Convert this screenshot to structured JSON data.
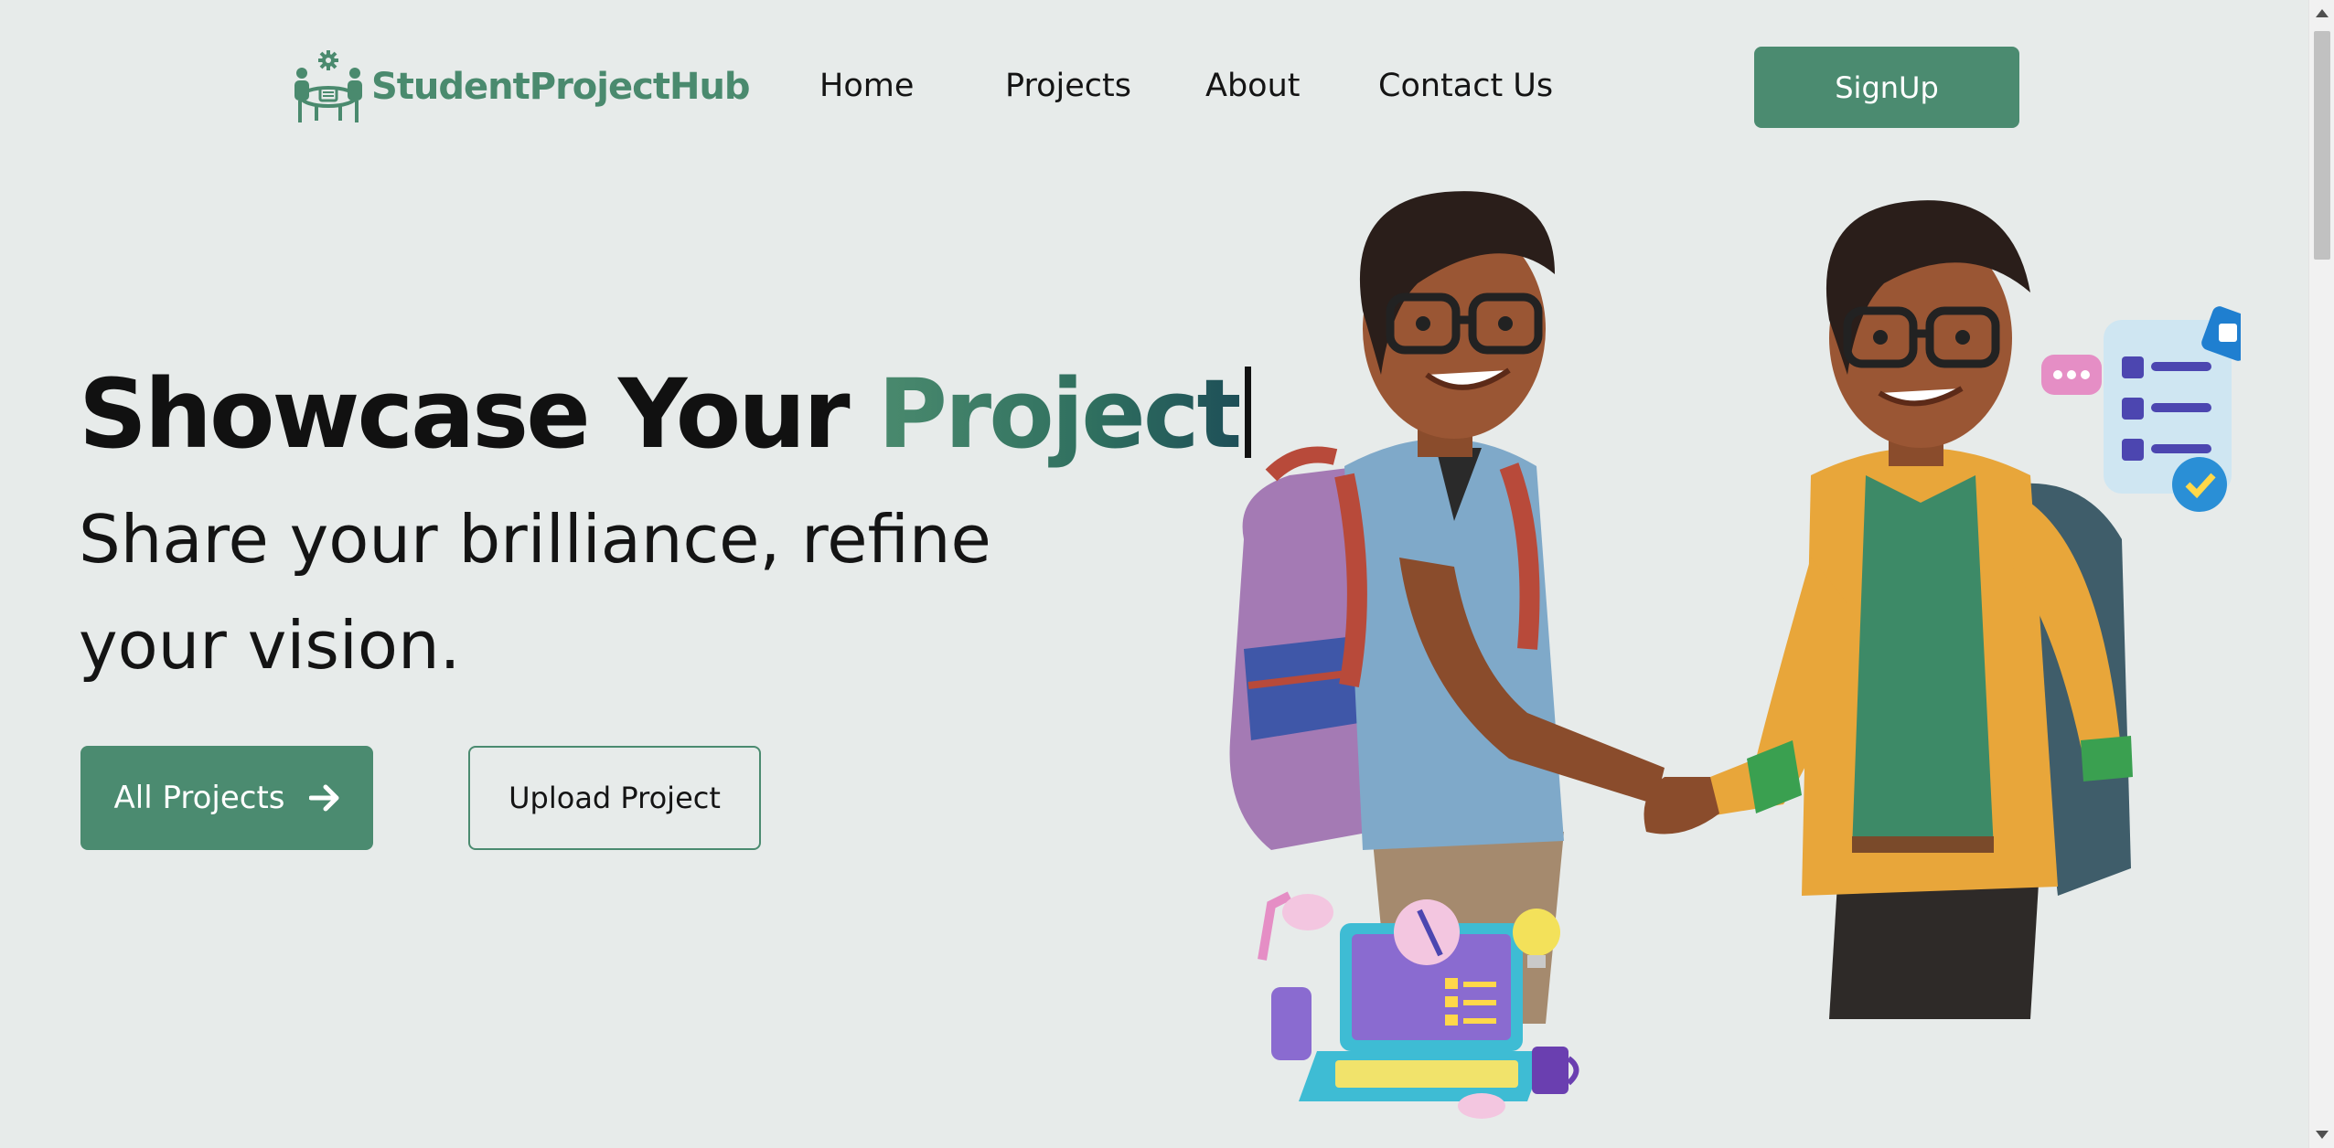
{
  "brand": {
    "name": "StudentProjectHub",
    "logo_icon": "team-meeting-gear-icon",
    "color": "#4b8b70"
  },
  "nav": {
    "links": [
      "Home",
      "Projects",
      "About",
      "Contact Us"
    ],
    "signup_label": "SignUp"
  },
  "hero": {
    "title_prefix": "Showcase Your ",
    "title_accent": "Project",
    "subtitle": "Share your brilliance, refine your vision.",
    "primary_button": "All Projects",
    "primary_icon": "arrow-right-icon",
    "secondary_button": "Upload Project"
  },
  "colors": {
    "background": "#e7ebea",
    "accent": "#4b8b70",
    "text": "#111111"
  }
}
